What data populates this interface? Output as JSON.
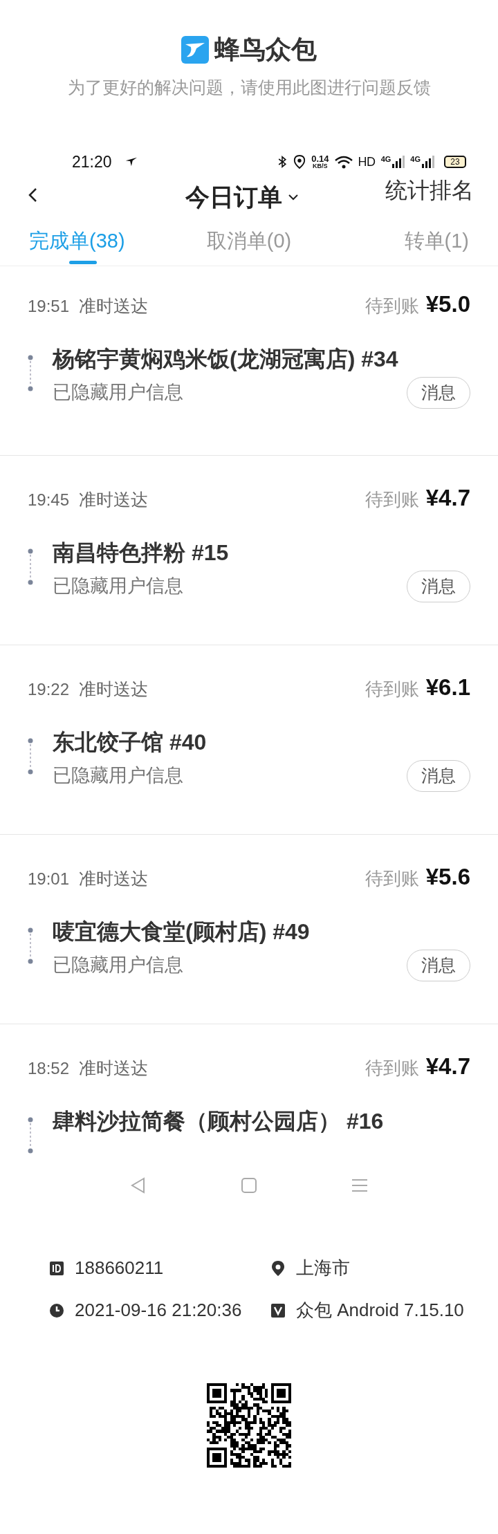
{
  "app_header": {
    "title": "蜂鸟众包",
    "subtitle": "为了更好的解决问题，请使用此图进行问题反馈"
  },
  "status_bar": {
    "time": "21:20",
    "net_speed": "0.14",
    "net_unit": "KB/S",
    "hd": "HD",
    "signal_labels": [
      "4G",
      "4G"
    ],
    "battery": "23"
  },
  "nav": {
    "title": "今日订单",
    "action": "统计排名"
  },
  "tabs": [
    {
      "label": "完成单(38)",
      "selected": true
    },
    {
      "label": "取消单(0)",
      "selected": false
    },
    {
      "label": "转单(1)",
      "selected": false
    }
  ],
  "orders": [
    {
      "time": "19:51",
      "status": "准时送达",
      "earning_label": "待到账",
      "amount": "¥5.0",
      "store": "杨铭宇黄焖鸡米饭(龙湖冠寓店) #34",
      "customer": "已隐藏用户信息",
      "button": "消息"
    },
    {
      "time": "19:45",
      "status": "准时送达",
      "earning_label": "待到账",
      "amount": "¥4.7",
      "store": "南昌特色拌粉 #15",
      "customer": "已隐藏用户信息",
      "button": "消息"
    },
    {
      "time": "19:22",
      "status": "准时送达",
      "earning_label": "待到账",
      "amount": "¥6.1",
      "store": "东北饺子馆 #40",
      "customer": "已隐藏用户信息",
      "button": "消息"
    },
    {
      "time": "19:01",
      "status": "准时送达",
      "earning_label": "待到账",
      "amount": "¥5.6",
      "store": "唛宜德大食堂(顾村店) #49",
      "customer": "已隐藏用户信息",
      "button": "消息"
    },
    {
      "time": "18:52",
      "status": "准时送达",
      "earning_label": "待到账",
      "amount": "¥4.7",
      "store": "肆料沙拉简餐（顾村公园店） #16"
    }
  ],
  "footer": {
    "rider_id": "188660211",
    "city": "上海市",
    "datetime": "2021-09-16 21:20:36",
    "version": "众包 Android 7.15.10"
  }
}
